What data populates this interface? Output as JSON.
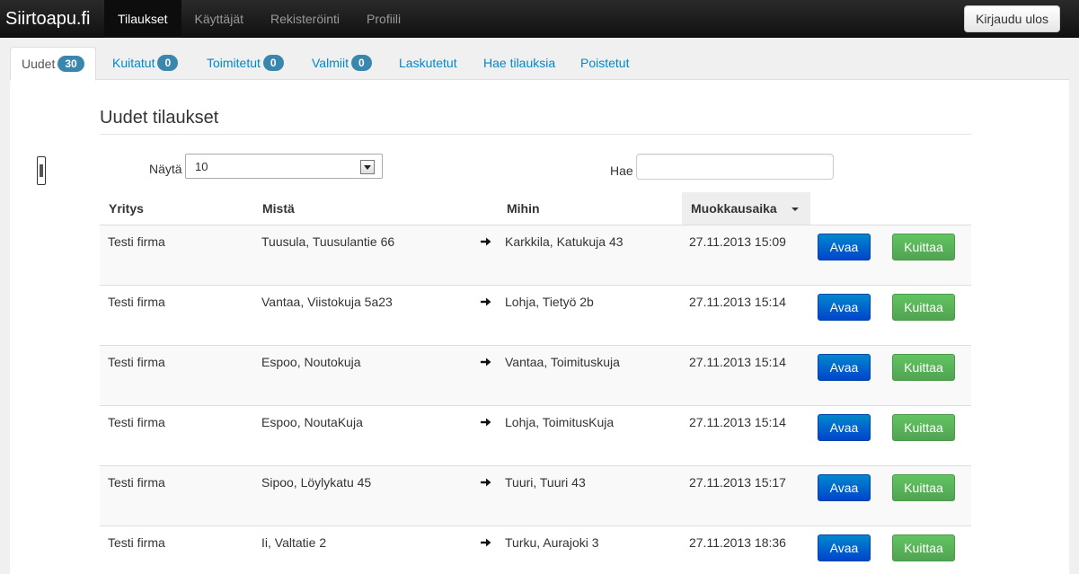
{
  "app": {
    "brand": "Siirtoapu.fi",
    "nav": [
      "Tilaukset",
      "Käyttäjät",
      "Rekisteröinti",
      "Profiili"
    ],
    "active_nav": "Tilaukset",
    "logout_label": "Kirjaudu ulos"
  },
  "tabs": [
    {
      "label": "Uudet",
      "badge": "30",
      "active": true
    },
    {
      "label": "Kuitatut",
      "badge": "0"
    },
    {
      "label": "Toimitetut",
      "badge": "0"
    },
    {
      "label": "Valmiit",
      "badge": "0"
    },
    {
      "label": "Laskutetut"
    },
    {
      "label": "Hae tilauksia"
    },
    {
      "label": "Poistetut"
    }
  ],
  "page": {
    "title": "Uudet tilaukset",
    "show_label": "Näytä",
    "show_value": "10",
    "search_label": "Hae",
    "search_value": ""
  },
  "table": {
    "columns": [
      "Yritys",
      "Mistä",
      "Mihin",
      "Muokkausaika"
    ],
    "sorted_column": "Muokkausaika",
    "open_label": "Avaa",
    "ack_label": "Kuittaa",
    "rows": [
      {
        "company": "Testi firma",
        "from": "Tuusula, Tuusulantie 66",
        "to": "Karkkila, Katukuja 43",
        "modified": "27.11.2013 15:09"
      },
      {
        "company": "Testi firma",
        "from": "Vantaa, Viistokuja 5a23",
        "to": "Lohja, Tietyö 2b",
        "modified": "27.11.2013 15:14"
      },
      {
        "company": "Testi firma",
        "from": "Espoo, Noutokuja",
        "to": "Vantaa, Toimituskuja",
        "modified": "27.11.2013 15:14"
      },
      {
        "company": "Testi firma",
        "from": "Espoo, NoutaKuja",
        "to": "Lohja, ToimitusKuja",
        "modified": "27.11.2013 15:14"
      },
      {
        "company": "Testi firma",
        "from": "Sipoo, Löylykatu 45",
        "to": "Tuuri, Tuuri 43",
        "modified": "27.11.2013 15:17"
      },
      {
        "company": "Testi firma",
        "from": "Ii, Valtatie 2",
        "to": "Turku, Aurajoki 3",
        "modified": "27.11.2013 18:36"
      }
    ]
  },
  "colors": {
    "navbar": "#1b1b1b",
    "link": "#0088cc",
    "badge": "#3a87ad",
    "primary": "#0055cc",
    "success": "#5bb75b"
  },
  "icons": {
    "route": "arrow-right-icon",
    "sort": "sort-desc-icon",
    "select": "chevron-down-icon"
  }
}
